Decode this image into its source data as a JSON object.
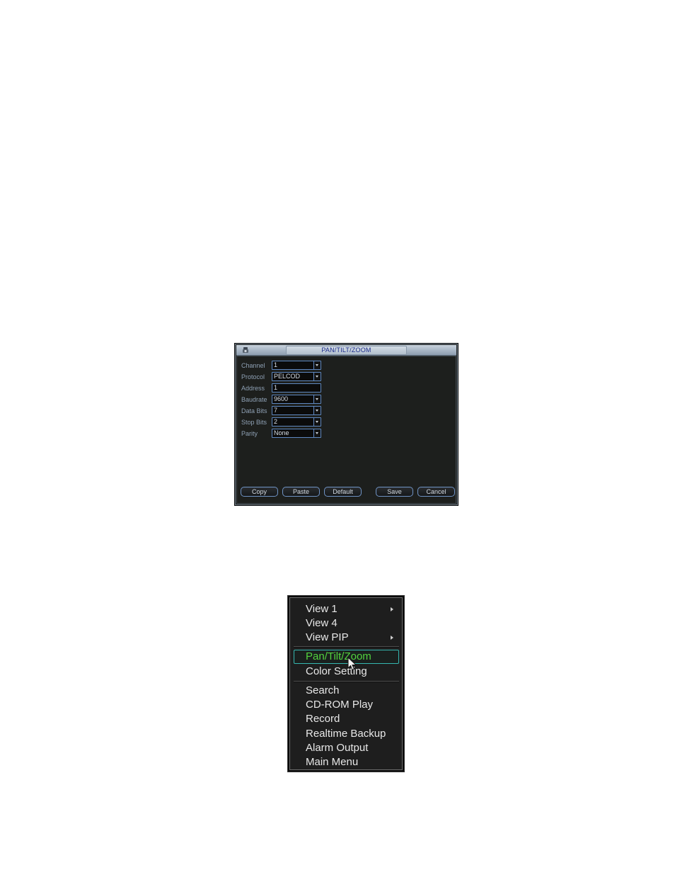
{
  "ptz_dialog": {
    "title": "PAN/TILT/ZOOM",
    "icon": "ptz-camera-icon",
    "fields": [
      {
        "label": "Channel",
        "value": "1",
        "dropdown": true
      },
      {
        "label": "Protocol",
        "value": "PELCOD",
        "dropdown": true
      },
      {
        "label": "Address",
        "value": "1",
        "dropdown": false
      },
      {
        "label": "Baudrate",
        "value": "9600",
        "dropdown": true
      },
      {
        "label": "Data Bits",
        "value": "7",
        "dropdown": true
      },
      {
        "label": "Stop Bits",
        "value": "2",
        "dropdown": true
      },
      {
        "label": "Parity",
        "value": "None",
        "dropdown": true
      }
    ],
    "buttons": {
      "copy": "Copy",
      "paste": "Paste",
      "default": "Default",
      "save": "Save",
      "cancel": "Cancel"
    }
  },
  "context_menu": {
    "groups": [
      [
        {
          "label": "View 1",
          "submenu": true
        },
        {
          "label": "View 4",
          "submenu": false
        },
        {
          "label": "View PIP",
          "submenu": true
        }
      ],
      [
        {
          "label": "Pan/Tilt/Zoom",
          "submenu": false,
          "selected": true
        },
        {
          "label": "Color Setting",
          "submenu": false
        }
      ],
      [
        {
          "label": "Search",
          "submenu": false
        },
        {
          "label": "CD-ROM Play",
          "submenu": false
        },
        {
          "label": "Record",
          "submenu": false
        },
        {
          "label": "Realtime Backup",
          "submenu": false
        },
        {
          "label": "Alarm Output",
          "submenu": false
        },
        {
          "label": "Main Menu",
          "submenu": false
        }
      ]
    ],
    "colors": {
      "selected_text": "#52d23e",
      "selected_border": "#35b7b0",
      "text": "#e8e8e8",
      "background": "#1e1e1e"
    }
  }
}
